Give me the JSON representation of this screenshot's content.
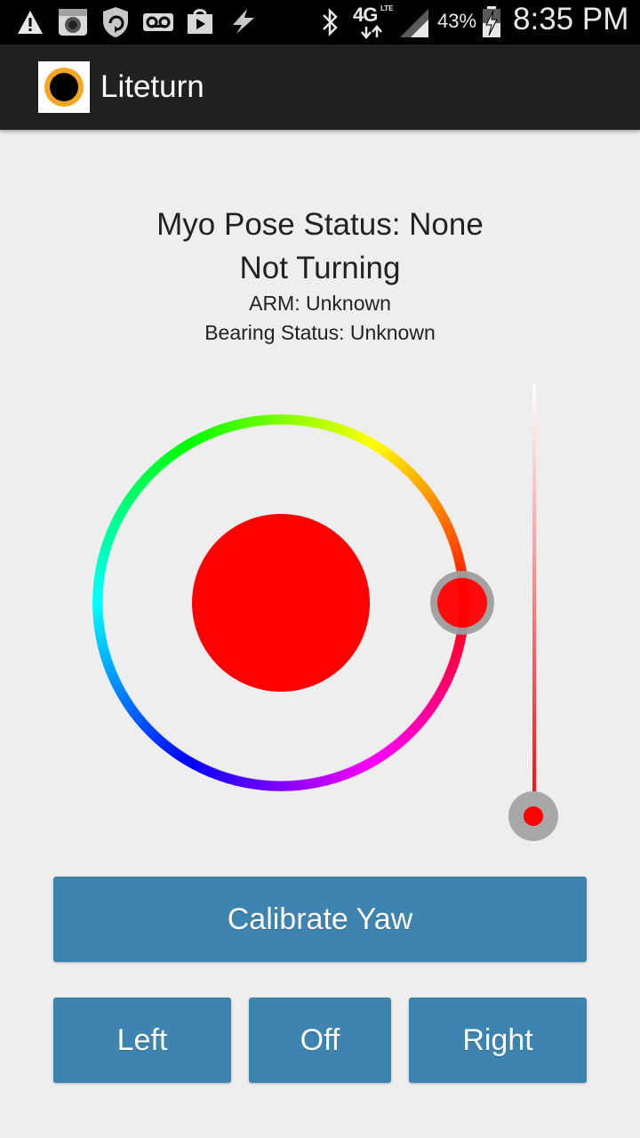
{
  "status_bar": {
    "battery": "43%",
    "network": "4G",
    "network_sub": "LTE",
    "time": "8:35 PM",
    "icons": [
      "warning-icon",
      "camera-app-icon",
      "shield-refresh-icon",
      "voicemail-icon",
      "play-store-icon",
      "flash-icon",
      "bluetooth-icon",
      "data-arrows-icon",
      "signal-icon",
      "battery-charging-icon"
    ]
  },
  "app": {
    "title": "Liteturn",
    "icon": "liteturn-logo-icon"
  },
  "status": {
    "pose": "Myo Pose Status: None",
    "turning": "Not Turning",
    "arm": "ARM: Unknown",
    "bearing": "Bearing Status: Unknown"
  },
  "color_wheel": {
    "selected_color": "#ff0000",
    "hue_degrees": 0
  },
  "value_slider": {
    "value": 1.0,
    "color": "#ff0000"
  },
  "buttons": {
    "calibrate": "Calibrate Yaw",
    "left": "Left",
    "off": "Off",
    "right": "Right",
    "color": "#3d85b0"
  }
}
